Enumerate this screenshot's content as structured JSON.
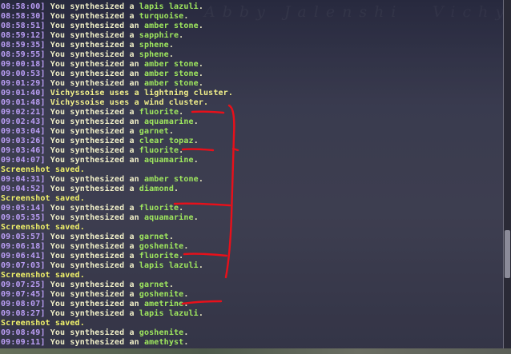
{
  "watermark": "Abby Jalenshi",
  "watermark2": "Vichy",
  "colors": {
    "timestamp": "#bb9ef6",
    "message": "#f1f0c8",
    "item": "#9fe85e",
    "notice": "#f1ef8a",
    "system": "#f1f26a",
    "annotation": "#e8101a"
  },
  "chat_lines": [
    {
      "ts": "08:58:00]",
      "msg": "You synthesized a ",
      "item": "lapis lazuli",
      "end": "."
    },
    {
      "ts": "08:58:30]",
      "msg": "You synthesized a ",
      "item": "turquoise",
      "end": "."
    },
    {
      "ts": "08:58:51]",
      "msg": "You synthesized an ",
      "item": "amber stone",
      "end": "."
    },
    {
      "ts": "08:59:12]",
      "msg": "You synthesized a ",
      "item": "sapphire",
      "end": "."
    },
    {
      "ts": "08:59:35]",
      "msg": "You synthesized a ",
      "item": "sphene",
      "end": "."
    },
    {
      "ts": "08:59:55]",
      "msg": "You synthesized a ",
      "item": "sphene",
      "end": "."
    },
    {
      "ts": "09:00:18]",
      "msg": "You synthesized an ",
      "item": "amber stone",
      "end": "."
    },
    {
      "ts": "09:00:53]",
      "msg": "You synthesized an ",
      "item": "amber stone",
      "end": "."
    },
    {
      "ts": "09:01:29]",
      "msg": "You synthesized an ",
      "item": "amber stone",
      "end": "."
    },
    {
      "ts": "09:01:40]",
      "notice": "Vichyssoise uses a lightning cluster."
    },
    {
      "ts": "09:01:48]",
      "notice": "Vichyssoise uses a wind cluster."
    },
    {
      "ts": "09:02:21]",
      "msg": "You synthesized a ",
      "item": "fluorite",
      "end": "."
    },
    {
      "ts": "09:02:43]",
      "msg": "You synthesized an ",
      "item": "aquamarine",
      "end": "."
    },
    {
      "ts": "09:03:04]",
      "msg": "You synthesized a ",
      "item": "garnet",
      "end": "."
    },
    {
      "ts": "09:03:26]",
      "msg": "You synthesized a ",
      "item": "clear topaz",
      "end": "."
    },
    {
      "ts": "09:03:46]",
      "msg": "You synthesized a ",
      "item": "fluorite",
      "end": "."
    },
    {
      "ts": "09:04:07]",
      "msg": "You synthesized an ",
      "item": "aquamarine",
      "end": "."
    },
    {
      "sys": "Screenshot saved."
    },
    {
      "ts": "09:04:31]",
      "msg": "You synthesized an ",
      "item": "amber stone",
      "end": "."
    },
    {
      "ts": "09:04:52]",
      "msg": "You synthesized a ",
      "item": "diamond",
      "end": "."
    },
    {
      "sys": "Screenshot saved."
    },
    {
      "ts": "09:05:14]",
      "msg": "You synthesized a ",
      "item": "fluorite",
      "end": "."
    },
    {
      "ts": "09:05:35]",
      "msg": "You synthesized an ",
      "item": "aquamarine",
      "end": "."
    },
    {
      "sys": "Screenshot saved."
    },
    {
      "ts": "09:05:57]",
      "msg": "You synthesized a ",
      "item": "garnet",
      "end": "."
    },
    {
      "ts": "09:06:18]",
      "msg": "You synthesized a ",
      "item": "goshenite",
      "end": "."
    },
    {
      "ts": "09:06:41]",
      "msg": "You synthesized a ",
      "item": "fluorite",
      "end": "."
    },
    {
      "ts": "09:07:03]",
      "msg": "You synthesized a ",
      "item": "lapis lazuli",
      "end": "."
    },
    {
      "sys": "Screenshot saved."
    },
    {
      "ts": "09:07:25]",
      "msg": "You synthesized a ",
      "item": "garnet",
      "end": "."
    },
    {
      "ts": "09:07:45]",
      "msg": "You synthesized a ",
      "item": "goshenite",
      "end": "."
    },
    {
      "ts": "09:08:07]",
      "msg": "You synthesized an ",
      "item": "ametrine",
      "end": "."
    },
    {
      "ts": "09:08:27]",
      "msg": "You synthesized a ",
      "item": "lapis lazuli",
      "end": "."
    },
    {
      "sys": "Screenshot saved."
    },
    {
      "ts": "09:08:49]",
      "msg": "You synthesized a ",
      "item": "goshenite",
      "end": "."
    },
    {
      "ts": "09:09:11]",
      "msg": "You synthesized an ",
      "item": "amethyst",
      "end": "."
    }
  ]
}
